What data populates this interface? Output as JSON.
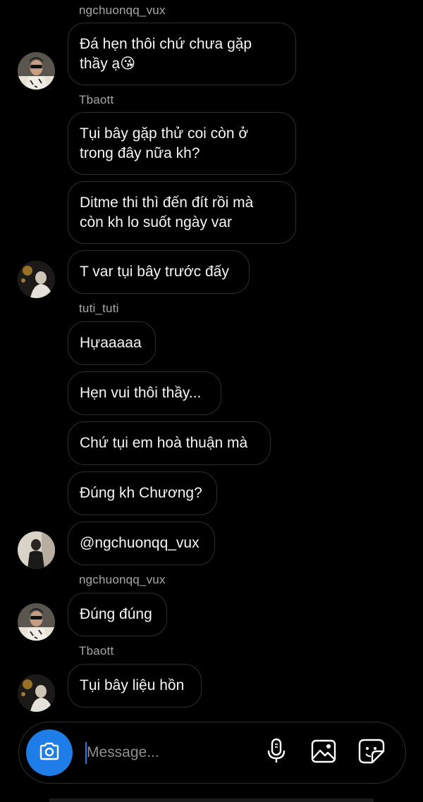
{
  "messages": [
    {
      "sender": "ngchuonqq_vux",
      "text": "Đá hẹn thôi chứ chưa gặp\nthầy ạ😘"
    },
    {
      "sender": "Tbaott",
      "text": "Tụi bây gặp thử coi còn ở\ntrong đây nữa kh?"
    },
    {
      "text": "Ditme thi thì đến đít rồi mà\ncòn kh lo suốt ngày var"
    },
    {
      "text": "T var tụi bây trước đấy"
    },
    {
      "sender": "tuti_tuti",
      "text": "Hựaaaaa"
    },
    {
      "text": "Hẹn vui thôi thầy..."
    },
    {
      "text": "Chứ tụi em hoà thuận mà"
    },
    {
      "text": "Đúng kh Chương?"
    },
    {
      "text": "@ngchuonqq_vux"
    },
    {
      "sender": "ngchuonqq_vux",
      "text": "Đúng đúng"
    },
    {
      "sender": "Tbaott",
      "text": "Tụi bây liệu hồn"
    }
  ],
  "composer": {
    "placeholder": "Message...",
    "value": "",
    "icons": [
      "camera-icon",
      "microphone-icon",
      "gallery-icon",
      "sticker-icon"
    ],
    "accent": "#1f7de8"
  },
  "colors": {
    "background": "#000000",
    "bubble_border": "#2e2e2e",
    "sender_text": "#a8a8a8"
  }
}
